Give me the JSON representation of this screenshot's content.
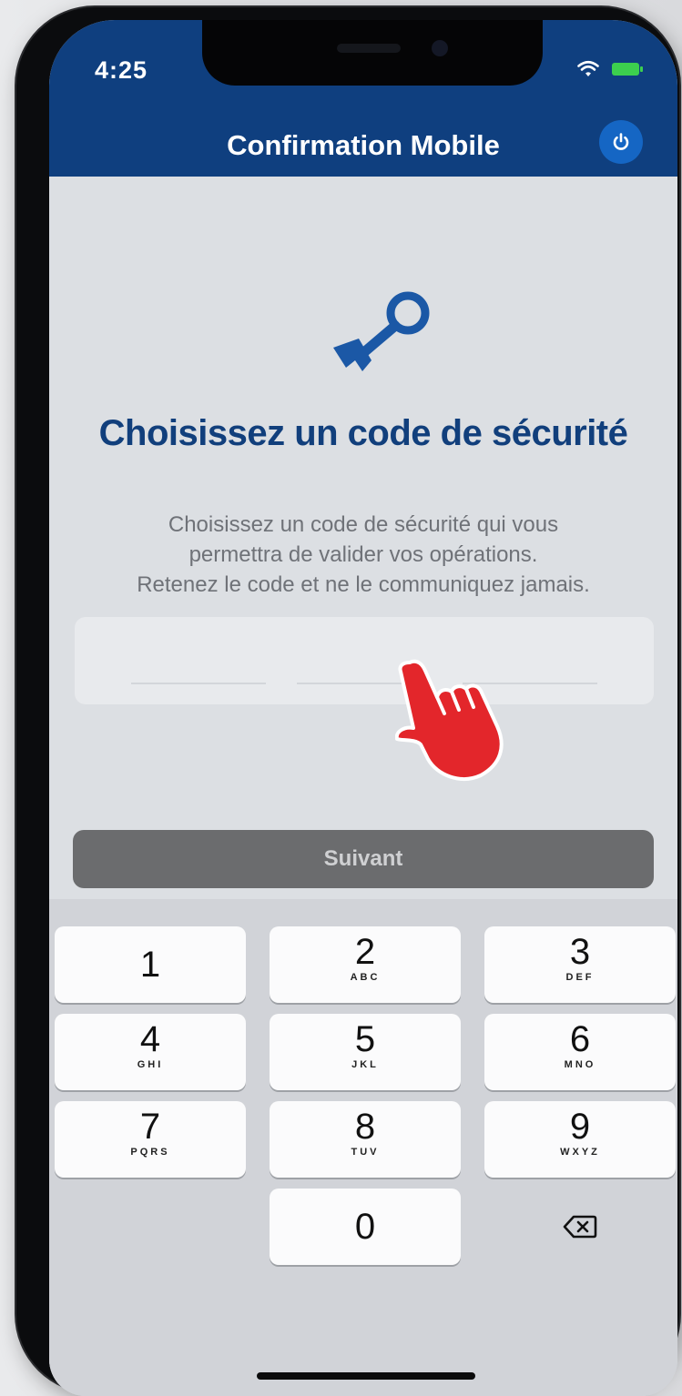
{
  "status_bar": {
    "time": "4:25",
    "icons": [
      "wifi-icon",
      "battery-icon"
    ]
  },
  "header": {
    "title": "Confirmation Mobile",
    "power_icon": "power-icon"
  },
  "main": {
    "key_icon": "key-icon",
    "title": "Choisissez un code de sécurité",
    "description_lines": [
      "Choisissez un code de sécurité qui vous",
      "permettra de valider vos opérations.",
      "Retenez le code et ne le communiquez jamais."
    ],
    "code_input_value": ""
  },
  "next_button": {
    "label": "Suivant"
  },
  "keypad": {
    "keys": [
      {
        "digit": "1",
        "letters": ""
      },
      {
        "digit": "2",
        "letters": "ABC"
      },
      {
        "digit": "3",
        "letters": "DEF"
      },
      {
        "digit": "4",
        "letters": "GHI"
      },
      {
        "digit": "5",
        "letters": "JKL"
      },
      {
        "digit": "6",
        "letters": "MNO"
      },
      {
        "digit": "7",
        "letters": "PQRS"
      },
      {
        "digit": "8",
        "letters": "TUV"
      },
      {
        "digit": "9",
        "letters": "WXYZ"
      },
      {
        "digit": "0",
        "letters": ""
      }
    ],
    "backspace_icon": "backspace-icon"
  },
  "colors": {
    "header_bg": "#0f3f7f",
    "title": "#113f7c",
    "power_button": "#1566c4",
    "key_icon": "#1b58a6",
    "pointer_hand": "#e3262b",
    "next_button_bg": "#6b6c6e"
  }
}
